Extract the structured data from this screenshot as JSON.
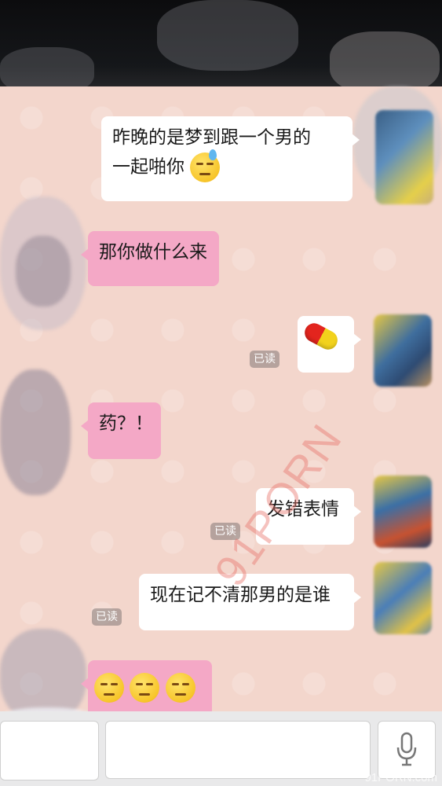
{
  "messages": [
    {
      "side": "right",
      "style": "white",
      "text_line1": "昨晚的是梦到跟一个男的",
      "text_line2": "一起啪你",
      "emoji": "sweat-unamused-face"
    },
    {
      "side": "left",
      "style": "pink",
      "text": "那你做什么来"
    },
    {
      "side": "right",
      "style": "white",
      "emoji": "pill",
      "read": "已读"
    },
    {
      "side": "left",
      "style": "pink",
      "text": "药？！"
    },
    {
      "side": "right",
      "style": "white",
      "text": "发错表情",
      "read": "已读"
    },
    {
      "side": "right",
      "style": "white",
      "text": "现在记不清那男的是谁",
      "read": "已读"
    },
    {
      "side": "left",
      "style": "pink",
      "emoji": "unamused-face x3"
    }
  ],
  "input": {
    "placeholder": "",
    "value": ""
  },
  "icons": {
    "mic": "microphone-icon"
  },
  "watermark": {
    "diagonal": "91PORN",
    "corner": "91PORN.com"
  },
  "colors": {
    "background": "#f3d6cc",
    "bubble_pink": "#f4a8c6",
    "bubble_white": "#ffffff",
    "read_badge": "#8a7f7c"
  }
}
